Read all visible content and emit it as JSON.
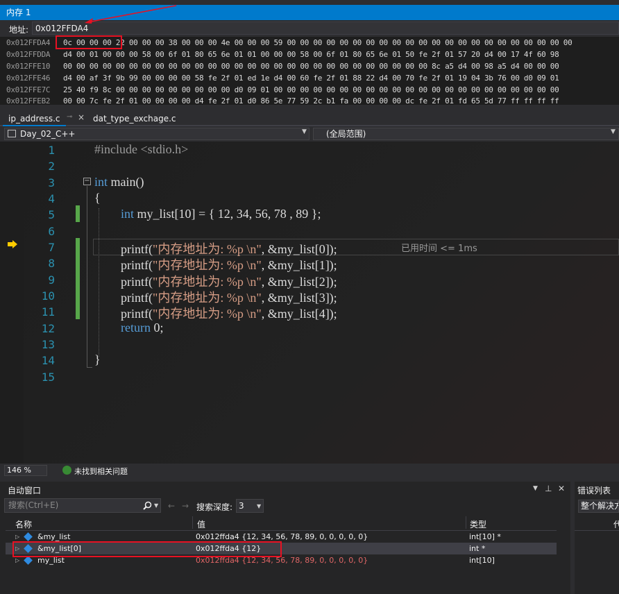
{
  "memory_window": {
    "title": "内存 1",
    "address_label": "地址:",
    "address_value": "0x012FFDA4",
    "rows": [
      {
        "addr": "0x012FFDA4",
        "bytes": "0c 00 00 00 22 00 00 00 38 00 00 00 4e 00 00 00 59 00 00 00 00 00 00 00 00 00 00 00 00 00 00 00 00 00 00 00 00 00 00"
      },
      {
        "addr": "0x012FFDDA",
        "bytes": "d4 00 01 00 00 00 58 00 6f 01 80 65 6e 01 01 00 00 00 58 00 6f 01 80 65 6e 01 50 fe 2f 01 57 20 d4 00 17 4f 60 98"
      },
      {
        "addr": "0x012FFE10",
        "bytes": "00 00 00 00 00 00 00 00 00 00 00 00 00 00 00 00 00 00 00 00 00 00 00 00 00 00 00 00 8c a5 d4 00 98 a5 d4 00 00 00"
      },
      {
        "addr": "0x012FFE46",
        "bytes": "d4 00 af 3f 9b 99 00 00 00 00 58 fe 2f 01 ed 1e d4 00 60 fe 2f 01 88 22 d4 00 70 fe 2f 01 19 04 3b 76 00 d0 09 01"
      },
      {
        "addr": "0x012FFE7C",
        "bytes": "25 40 f9 8c 00 00 00 00 00 00 00 00 00 d0 09 01 00 00 00 00 00 00 00 00 00 00 00 00 00 00 00 00 00 00 00 00 00 00"
      },
      {
        "addr": "0x012FFEB2",
        "bytes": "00 00 7c fe 2f 01 00 00 00 00 d4 fe 2f 01 d0 86 5e 77 59 2c b1 fa 00 00 00 00 dc fe 2f 01 fd 65 5d 77 ff ff ff ff"
      }
    ]
  },
  "tabs": {
    "active": "ip_address.c",
    "pin_icon": "pin-icon",
    "close": "×",
    "other": "dat_type_exchage.c"
  },
  "navbar": {
    "project": "Day_02_C++",
    "scope": "(全局范围)"
  },
  "editor": {
    "line_numbers": [
      "1",
      "2",
      "3",
      "4",
      "5",
      "6",
      "7",
      "8",
      "9",
      "10",
      "11",
      "12",
      "13",
      "14",
      "15"
    ],
    "include": "#include <stdio.h>",
    "main_kw": "int",
    "main_rest": " main()",
    "brace_open": "{",
    "decl_kw": "int",
    "decl_rest": " my_list[10] = { 12, 34, 56, 78 , 89 };",
    "printf_lines": [
      {
        "pre": "printf(",
        "str": "\"内存地址为: %p \\n\"",
        "post": ", &my_list[0]);"
      },
      {
        "pre": "printf(",
        "str": "\"内存地址为: %p \\n\"",
        "post": ", &my_list[1]);"
      },
      {
        "pre": "printf(",
        "str": "\"内存地址为: %p \\n\"",
        "post": ", &my_list[2]);"
      },
      {
        "pre": "printf(",
        "str": "\"内存地址为: %p \\n\"",
        "post": ", &my_list[3]);"
      },
      {
        "pre": "printf(",
        "str": "\"内存地址为: %p \\n\"",
        "post": ", &my_list[4]);"
      }
    ],
    "return_kw": "return",
    "return_rest": " 0;",
    "brace_close": "}",
    "elapsed": "已用时间 <= 1ms",
    "collapse": "−"
  },
  "status": {
    "zoom": "146 %",
    "issues": "未找到相关问题"
  },
  "autos": {
    "title": "自动窗口",
    "search_placeholder": "搜索(Ctrl+E)",
    "depth_label": "搜索深度:",
    "depth_value": "3",
    "columns": [
      "名称",
      "值",
      "类型"
    ],
    "rows": [
      {
        "name": "&my_list",
        "value": "0x012ffda4 {12, 34, 56, 78, 89, 0, 0, 0, 0, 0}",
        "type": "int[10] *"
      },
      {
        "name": "&my_list[0]",
        "value": "0x012ffda4 {12}",
        "type": "int *"
      },
      {
        "name": "my_list",
        "value": "0x012ffda4 {12, 34, 56, 78, 89, 0, 0, 0, 0, 0}",
        "type": "int[10]"
      }
    ]
  },
  "errors": {
    "title": "错误列表",
    "filter": "整个解决方案",
    "col": "代"
  },
  "colors": {
    "accent": "#007acc",
    "annotation": "#e81123",
    "keyword": "#569cd6",
    "string": "#d69d85",
    "line_number": "#2b91af"
  }
}
